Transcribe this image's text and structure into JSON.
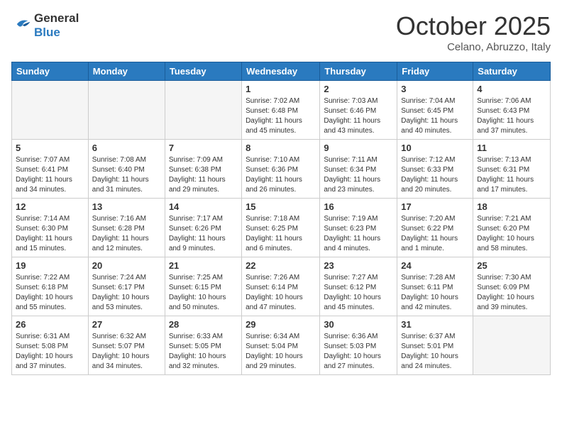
{
  "header": {
    "logo_general": "General",
    "logo_blue": "Blue",
    "month": "October 2025",
    "location": "Celano, Abruzzo, Italy"
  },
  "weekdays": [
    "Sunday",
    "Monday",
    "Tuesday",
    "Wednesday",
    "Thursday",
    "Friday",
    "Saturday"
  ],
  "weeks": [
    [
      {
        "day": "",
        "info": ""
      },
      {
        "day": "",
        "info": ""
      },
      {
        "day": "",
        "info": ""
      },
      {
        "day": "1",
        "info": "Sunrise: 7:02 AM\nSunset: 6:48 PM\nDaylight: 11 hours and 45 minutes."
      },
      {
        "day": "2",
        "info": "Sunrise: 7:03 AM\nSunset: 6:46 PM\nDaylight: 11 hours and 43 minutes."
      },
      {
        "day": "3",
        "info": "Sunrise: 7:04 AM\nSunset: 6:45 PM\nDaylight: 11 hours and 40 minutes."
      },
      {
        "day": "4",
        "info": "Sunrise: 7:06 AM\nSunset: 6:43 PM\nDaylight: 11 hours and 37 minutes."
      }
    ],
    [
      {
        "day": "5",
        "info": "Sunrise: 7:07 AM\nSunset: 6:41 PM\nDaylight: 11 hours and 34 minutes."
      },
      {
        "day": "6",
        "info": "Sunrise: 7:08 AM\nSunset: 6:40 PM\nDaylight: 11 hours and 31 minutes."
      },
      {
        "day": "7",
        "info": "Sunrise: 7:09 AM\nSunset: 6:38 PM\nDaylight: 11 hours and 29 minutes."
      },
      {
        "day": "8",
        "info": "Sunrise: 7:10 AM\nSunset: 6:36 PM\nDaylight: 11 hours and 26 minutes."
      },
      {
        "day": "9",
        "info": "Sunrise: 7:11 AM\nSunset: 6:34 PM\nDaylight: 11 hours and 23 minutes."
      },
      {
        "day": "10",
        "info": "Sunrise: 7:12 AM\nSunset: 6:33 PM\nDaylight: 11 hours and 20 minutes."
      },
      {
        "day": "11",
        "info": "Sunrise: 7:13 AM\nSunset: 6:31 PM\nDaylight: 11 hours and 17 minutes."
      }
    ],
    [
      {
        "day": "12",
        "info": "Sunrise: 7:14 AM\nSunset: 6:30 PM\nDaylight: 11 hours and 15 minutes."
      },
      {
        "day": "13",
        "info": "Sunrise: 7:16 AM\nSunset: 6:28 PM\nDaylight: 11 hours and 12 minutes."
      },
      {
        "day": "14",
        "info": "Sunrise: 7:17 AM\nSunset: 6:26 PM\nDaylight: 11 hours and 9 minutes."
      },
      {
        "day": "15",
        "info": "Sunrise: 7:18 AM\nSunset: 6:25 PM\nDaylight: 11 hours and 6 minutes."
      },
      {
        "day": "16",
        "info": "Sunrise: 7:19 AM\nSunset: 6:23 PM\nDaylight: 11 hours and 4 minutes."
      },
      {
        "day": "17",
        "info": "Sunrise: 7:20 AM\nSunset: 6:22 PM\nDaylight: 11 hours and 1 minute."
      },
      {
        "day": "18",
        "info": "Sunrise: 7:21 AM\nSunset: 6:20 PM\nDaylight: 10 hours and 58 minutes."
      }
    ],
    [
      {
        "day": "19",
        "info": "Sunrise: 7:22 AM\nSunset: 6:18 PM\nDaylight: 10 hours and 55 minutes."
      },
      {
        "day": "20",
        "info": "Sunrise: 7:24 AM\nSunset: 6:17 PM\nDaylight: 10 hours and 53 minutes."
      },
      {
        "day": "21",
        "info": "Sunrise: 7:25 AM\nSunset: 6:15 PM\nDaylight: 10 hours and 50 minutes."
      },
      {
        "day": "22",
        "info": "Sunrise: 7:26 AM\nSunset: 6:14 PM\nDaylight: 10 hours and 47 minutes."
      },
      {
        "day": "23",
        "info": "Sunrise: 7:27 AM\nSunset: 6:12 PM\nDaylight: 10 hours and 45 minutes."
      },
      {
        "day": "24",
        "info": "Sunrise: 7:28 AM\nSunset: 6:11 PM\nDaylight: 10 hours and 42 minutes."
      },
      {
        "day": "25",
        "info": "Sunrise: 7:30 AM\nSunset: 6:09 PM\nDaylight: 10 hours and 39 minutes."
      }
    ],
    [
      {
        "day": "26",
        "info": "Sunrise: 6:31 AM\nSunset: 5:08 PM\nDaylight: 10 hours and 37 minutes."
      },
      {
        "day": "27",
        "info": "Sunrise: 6:32 AM\nSunset: 5:07 PM\nDaylight: 10 hours and 34 minutes."
      },
      {
        "day": "28",
        "info": "Sunrise: 6:33 AM\nSunset: 5:05 PM\nDaylight: 10 hours and 32 minutes."
      },
      {
        "day": "29",
        "info": "Sunrise: 6:34 AM\nSunset: 5:04 PM\nDaylight: 10 hours and 29 minutes."
      },
      {
        "day": "30",
        "info": "Sunrise: 6:36 AM\nSunset: 5:03 PM\nDaylight: 10 hours and 27 minutes."
      },
      {
        "day": "31",
        "info": "Sunrise: 6:37 AM\nSunset: 5:01 PM\nDaylight: 10 hours and 24 minutes."
      },
      {
        "day": "",
        "info": ""
      }
    ]
  ]
}
